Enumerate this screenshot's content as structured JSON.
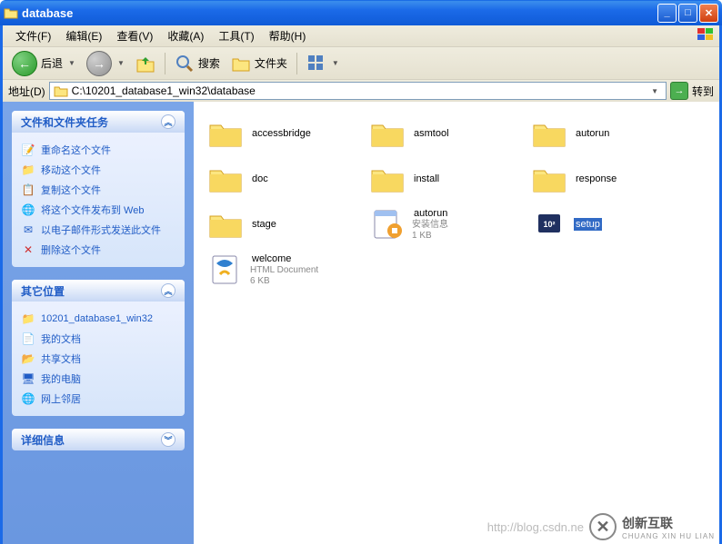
{
  "window": {
    "title": "database"
  },
  "menu": {
    "items": [
      "文件(F)",
      "编辑(E)",
      "查看(V)",
      "收藏(A)",
      "工具(T)",
      "帮助(H)"
    ]
  },
  "toolbar": {
    "back": "后退",
    "search": "搜索",
    "folders": "文件夹"
  },
  "address": {
    "label": "地址(D)",
    "path": "C:\\10201_database1_win32\\database",
    "go": "转到"
  },
  "sidebar": {
    "tasks": {
      "title": "文件和文件夹任务",
      "items": [
        {
          "icon": "rename-icon",
          "label": "重命名这个文件"
        },
        {
          "icon": "move-icon",
          "label": "移动这个文件"
        },
        {
          "icon": "copy-icon",
          "label": "复制这个文件"
        },
        {
          "icon": "publish-icon",
          "label": "将这个文件发布到 Web"
        },
        {
          "icon": "email-icon",
          "label": "以电子邮件形式发送此文件"
        },
        {
          "icon": "delete-icon",
          "label": "删除这个文件"
        }
      ]
    },
    "places": {
      "title": "其它位置",
      "items": [
        {
          "icon": "folder-icon",
          "label": "10201_database1_win32"
        },
        {
          "icon": "docs-icon",
          "label": "我的文档"
        },
        {
          "icon": "shared-icon",
          "label": "共享文档"
        },
        {
          "icon": "computer-icon",
          "label": "我的电脑"
        },
        {
          "icon": "network-icon",
          "label": "网上邻居"
        }
      ]
    },
    "details": {
      "title": "详细信息"
    }
  },
  "files": [
    {
      "name": "accessbridge",
      "type": "folder"
    },
    {
      "name": "asmtool",
      "type": "folder"
    },
    {
      "name": "autorun",
      "type": "folder"
    },
    {
      "name": "doc",
      "type": "folder"
    },
    {
      "name": "install",
      "type": "folder"
    },
    {
      "name": "response",
      "type": "folder"
    },
    {
      "name": "stage",
      "type": "folder"
    },
    {
      "name": "autorun",
      "type": "inf",
      "meta1": "安装信息",
      "meta2": "1 KB"
    },
    {
      "name": "setup",
      "type": "exe",
      "selected": true
    },
    {
      "name": "welcome",
      "type": "html",
      "meta1": "HTML Document",
      "meta2": "6 KB"
    }
  ],
  "watermark": {
    "url": "http://blog.csdn.ne",
    "brand": "创新互联",
    "sub": "CHUANG XIN HU LIAN"
  }
}
